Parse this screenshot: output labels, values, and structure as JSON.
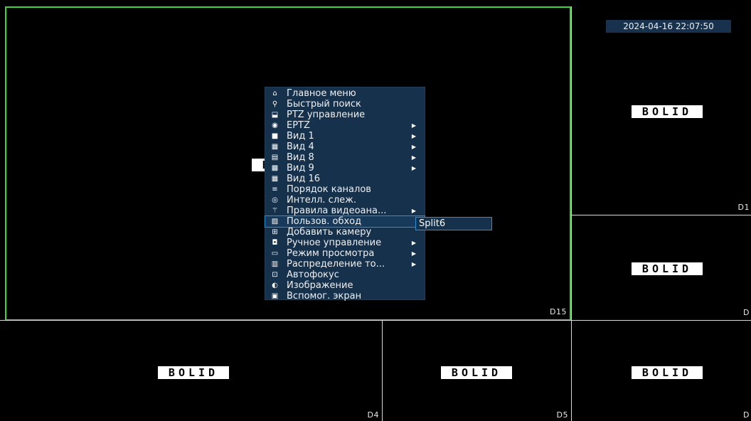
{
  "timestamp": "2024-04-16 22:07:50",
  "logo_text": "BOLID",
  "channels": {
    "main": "D15",
    "right_top": "D1",
    "right_mid": "D",
    "bottom_left": "D4",
    "bottom_mid": "D5",
    "bottom_right": "D"
  },
  "context_menu": {
    "items": [
      {
        "label": "Главное меню",
        "icon": "home-icon",
        "glyph": "⌂",
        "arrow": false
      },
      {
        "label": "Быстрый поиск",
        "icon": "search-icon",
        "glyph": "⚲",
        "arrow": false
      },
      {
        "label": "PTZ управление",
        "icon": "ptz-icon",
        "glyph": "⬓",
        "arrow": false
      },
      {
        "label": "EPTZ",
        "icon": "eptz-icon",
        "glyph": "◉",
        "arrow": true
      },
      {
        "label": "Вид 1",
        "icon": "view1-icon",
        "glyph": "■",
        "arrow": true
      },
      {
        "label": "Вид 4",
        "icon": "view4-icon",
        "glyph": "▦",
        "arrow": true
      },
      {
        "label": "Вид 8",
        "icon": "view8-icon",
        "glyph": "▤",
        "arrow": true
      },
      {
        "label": "Вид 9",
        "icon": "view9-icon",
        "glyph": "▩",
        "arrow": true
      },
      {
        "label": "Вид 16",
        "icon": "view16-icon",
        "glyph": "▦",
        "arrow": false
      },
      {
        "label": "Порядок каналов",
        "icon": "channel-order-icon",
        "glyph": "≡",
        "arrow": false
      },
      {
        "label": "Интелл. слеж.",
        "icon": "smart-track-icon",
        "glyph": "◎",
        "arrow": false
      },
      {
        "label": "Правила видеоана...",
        "icon": "video-analytics-icon",
        "glyph": "⚚",
        "arrow": true
      },
      {
        "label": "Пользов. обход",
        "icon": "tour-icon",
        "glyph": "▨",
        "arrow": false,
        "selected": true
      },
      {
        "label": "Добавить камеру",
        "icon": "add-camera-icon",
        "glyph": "⊞",
        "arrow": false
      },
      {
        "label": "Ручное управление",
        "icon": "manual-control-icon",
        "glyph": "◘",
        "arrow": true
      },
      {
        "label": "Режим просмотра",
        "icon": "view-mode-icon",
        "glyph": "▭",
        "arrow": true
      },
      {
        "label": "Распределение то...",
        "icon": "distribution-icon",
        "glyph": "▥",
        "arrow": true
      },
      {
        "label": "Автофокус",
        "icon": "autofocus-icon",
        "glyph": "⊡",
        "arrow": false
      },
      {
        "label": "Изображение",
        "icon": "image-icon",
        "glyph": "◐",
        "arrow": false
      },
      {
        "label": "Вспомог. экран",
        "icon": "aux-screen-icon",
        "glyph": "▣",
        "arrow": false
      }
    ]
  },
  "submenu": {
    "label": "Split6"
  },
  "colors": {
    "main_border": "#3fd23a",
    "menu_bg": "#15314c",
    "highlight": "#2a8fd6"
  }
}
